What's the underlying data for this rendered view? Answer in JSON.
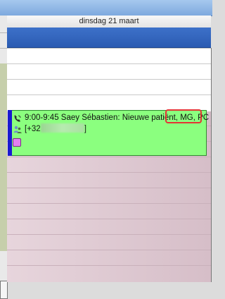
{
  "calendar": {
    "day_header": "dinsdag 21 maart"
  },
  "appointment": {
    "line1": "9:00-9:45 Saey Sébastien: Nieuwe patiënt, MG, PC",
    "phone_prefix": "[+32",
    "phone_suffix": "]",
    "status_color": "#e37ff1",
    "icons": [
      "phone-icon",
      "patient-icon"
    ]
  },
  "annotation": {
    "color": "#e33434",
    "highlight_target": "MG, PC"
  }
}
